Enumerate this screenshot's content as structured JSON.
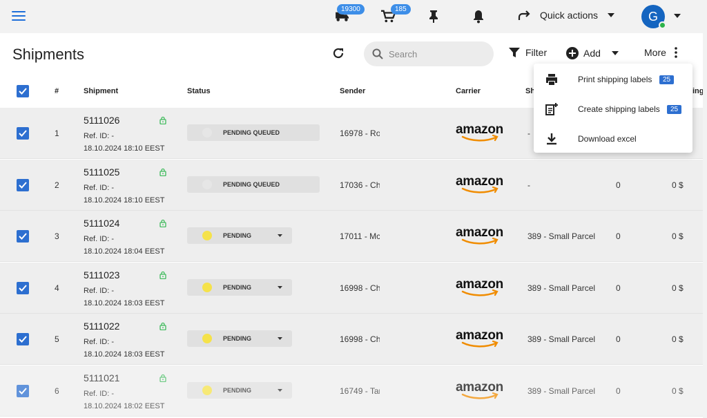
{
  "topbar": {
    "menu_icon": "menu-icon",
    "delivery_badge": "19300",
    "cart_badge": "185",
    "quick_actions_label": "Quick actions",
    "avatar_initial": "G",
    "accent": "#1e6fd9",
    "online_color": "#2db34a"
  },
  "header": {
    "title": "Shipments",
    "search_placeholder": "Search",
    "filter_label": "Filter",
    "add_label": "Add",
    "more_label": "More"
  },
  "more_menu": {
    "items": [
      {
        "label": "Print shipping labels",
        "badge": "25",
        "icon": "printer-icon"
      },
      {
        "label": "Create shipping labels",
        "badge": "25",
        "icon": "note-add-icon"
      },
      {
        "label": "Download excel",
        "icon": "download-icon"
      }
    ]
  },
  "table": {
    "columns": [
      "#",
      "Shipment",
      "Status",
      "Sender",
      "Carrier",
      "Sh",
      "ing"
    ],
    "carrier_logo_text": "amazon",
    "rows": [
      {
        "num": "1",
        "id": "5111026",
        "ref": "Ref. ID: -",
        "date": "18.10.2024 18:10 EEST",
        "status": "PENDING QUEUED",
        "status_color": "#e6e6e6",
        "sender": "16978 - Ro",
        "service": "-",
        "qty": "",
        "price": ""
      },
      {
        "num": "2",
        "id": "5111025",
        "ref": "Ref. ID: -",
        "date": "18.10.2024 18:10 EEST",
        "status": "PENDING QUEUED",
        "status_color": "#e6e6e6",
        "sender": "17036 - Ch",
        "service": "-",
        "qty": "0",
        "price": "0 $"
      },
      {
        "num": "3",
        "id": "5111024",
        "ref": "Ref. ID: -",
        "date": "18.10.2024 18:04 EEST",
        "status": "PENDING",
        "status_color": "#f5e24a",
        "sender": "17011 - Mc",
        "service": "389 - Small Parcel",
        "qty": "0",
        "price": "0 $"
      },
      {
        "num": "4",
        "id": "5111023",
        "ref": "Ref. ID: -",
        "date": "18.10.2024 18:03 EEST",
        "status": "PENDING",
        "status_color": "#f5e24a",
        "sender": "16998 - Ch",
        "service": "389 - Small Parcel",
        "qty": "0",
        "price": "0 $"
      },
      {
        "num": "5",
        "id": "5111022",
        "ref": "Ref. ID: -",
        "date": "18.10.2024 18:03 EEST",
        "status": "PENDING",
        "status_color": "#f5e24a",
        "sender": "16998 - Ch",
        "service": "389 - Small Parcel",
        "qty": "0",
        "price": "0 $"
      },
      {
        "num": "6",
        "id": "5111021",
        "ref": "Ref. ID: -",
        "date": "18.10.2024 18:02 EEST",
        "status": "PENDING",
        "status_color": "#f5e24a",
        "sender": "16749 - Tar",
        "service": "389 - Small Parcel",
        "qty": "0",
        "price": "0 $"
      }
    ]
  }
}
